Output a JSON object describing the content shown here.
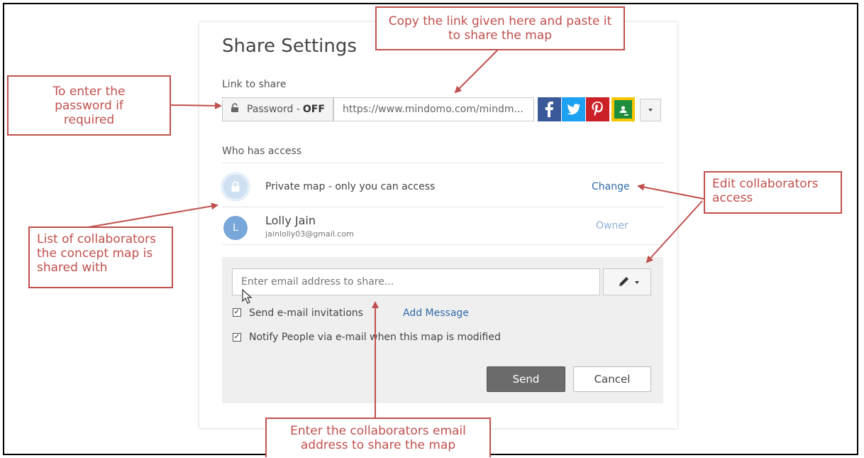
{
  "dialog": {
    "title": "Share Settings",
    "link_to_share_label": "Link to share",
    "password_label": "Password - ",
    "password_state": "OFF",
    "share_url": "https://www.mindomo.com/mindm...",
    "social_buttons": [
      "facebook-icon",
      "twitter-icon",
      "pinterest-icon",
      "google-classroom-icon"
    ],
    "who_has_access_label": "Who has access",
    "access_rows": [
      {
        "text": "Private map - only you can access",
        "action": "Change"
      },
      {
        "name": "Lolly Jain",
        "email": "jainlolly03@gmail.com",
        "avatar_letter": "L",
        "role": "Owner"
      }
    ],
    "email_placeholder": "Enter email address to share...",
    "send_invitations_label": "Send e-mail invitations",
    "add_message_label": "Add Message",
    "notify_label": "Notify People via e-mail when this map is modified",
    "send_label": "Send",
    "cancel_label": "Cancel"
  },
  "callouts": {
    "copy_link": "Copy the link given here and paste it to share the map",
    "password": "To enter the password if required",
    "collaborators_list": "List of collaborators the concept map is shared with",
    "edit_access": "Edit collaborators access",
    "enter_email": "Enter the collaborators email address to share the map"
  },
  "colors": {
    "callout_red": "#c0504d",
    "link_blue": "#2f6aa8",
    "send_button": "#6b6b6b"
  }
}
